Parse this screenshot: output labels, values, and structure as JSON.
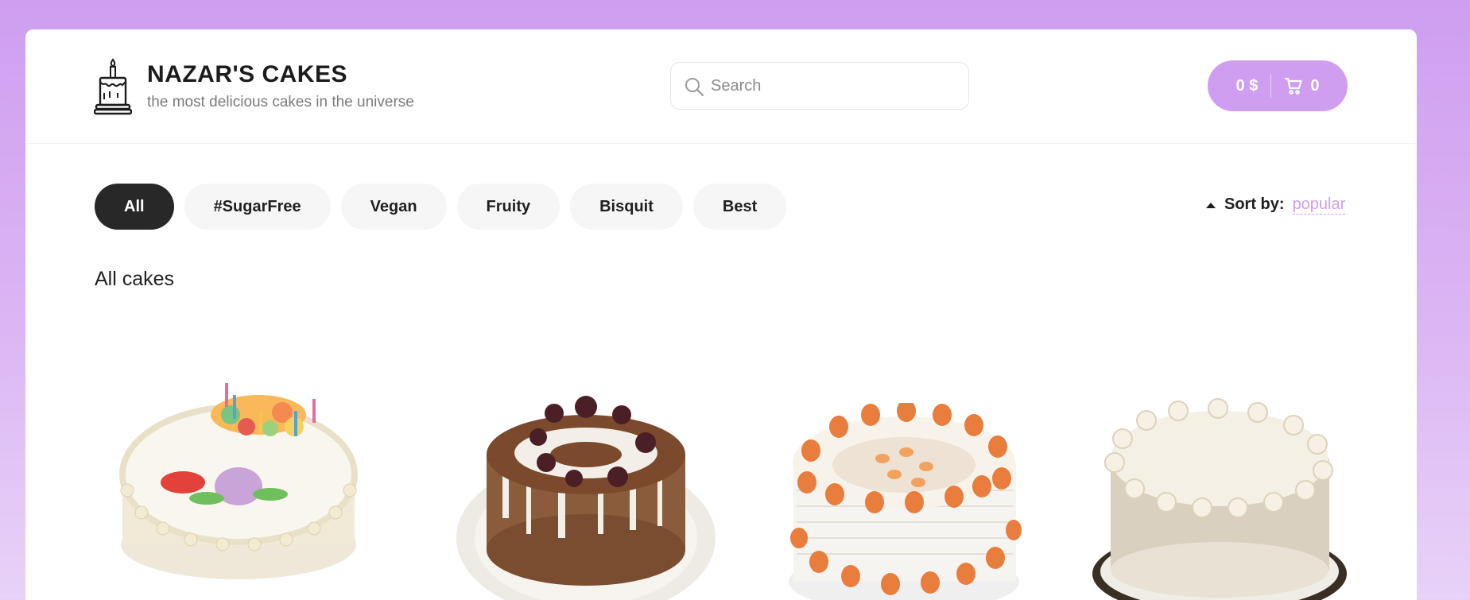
{
  "header": {
    "brand_title": "NAZAR'S CAKES",
    "brand_subtitle": "the most delicious cakes in the universe",
    "logo_icon": "cake-icon"
  },
  "search": {
    "placeholder": "Search",
    "value": ""
  },
  "cart": {
    "price": "0 $",
    "count": "0",
    "icon": "cart-icon"
  },
  "categories": [
    {
      "label": "All",
      "active": true
    },
    {
      "label": "#SugarFree",
      "active": false
    },
    {
      "label": "Vegan",
      "active": false
    },
    {
      "label": "Fruity",
      "active": false
    },
    {
      "label": "Bisquit",
      "active": false
    },
    {
      "label": "Best",
      "active": false
    }
  ],
  "sort": {
    "label": "Sort by:",
    "value": "popular"
  },
  "section_title": "All cakes",
  "products": [
    {
      "image": "birthday-cake-with-candles"
    },
    {
      "image": "black-forest-cake"
    },
    {
      "image": "fruit-cream-cake"
    },
    {
      "image": "white-cream-cake"
    }
  ],
  "colors": {
    "accent": "#cf9ef0",
    "active_category": "#282828",
    "chip": "#f6f6f6"
  }
}
